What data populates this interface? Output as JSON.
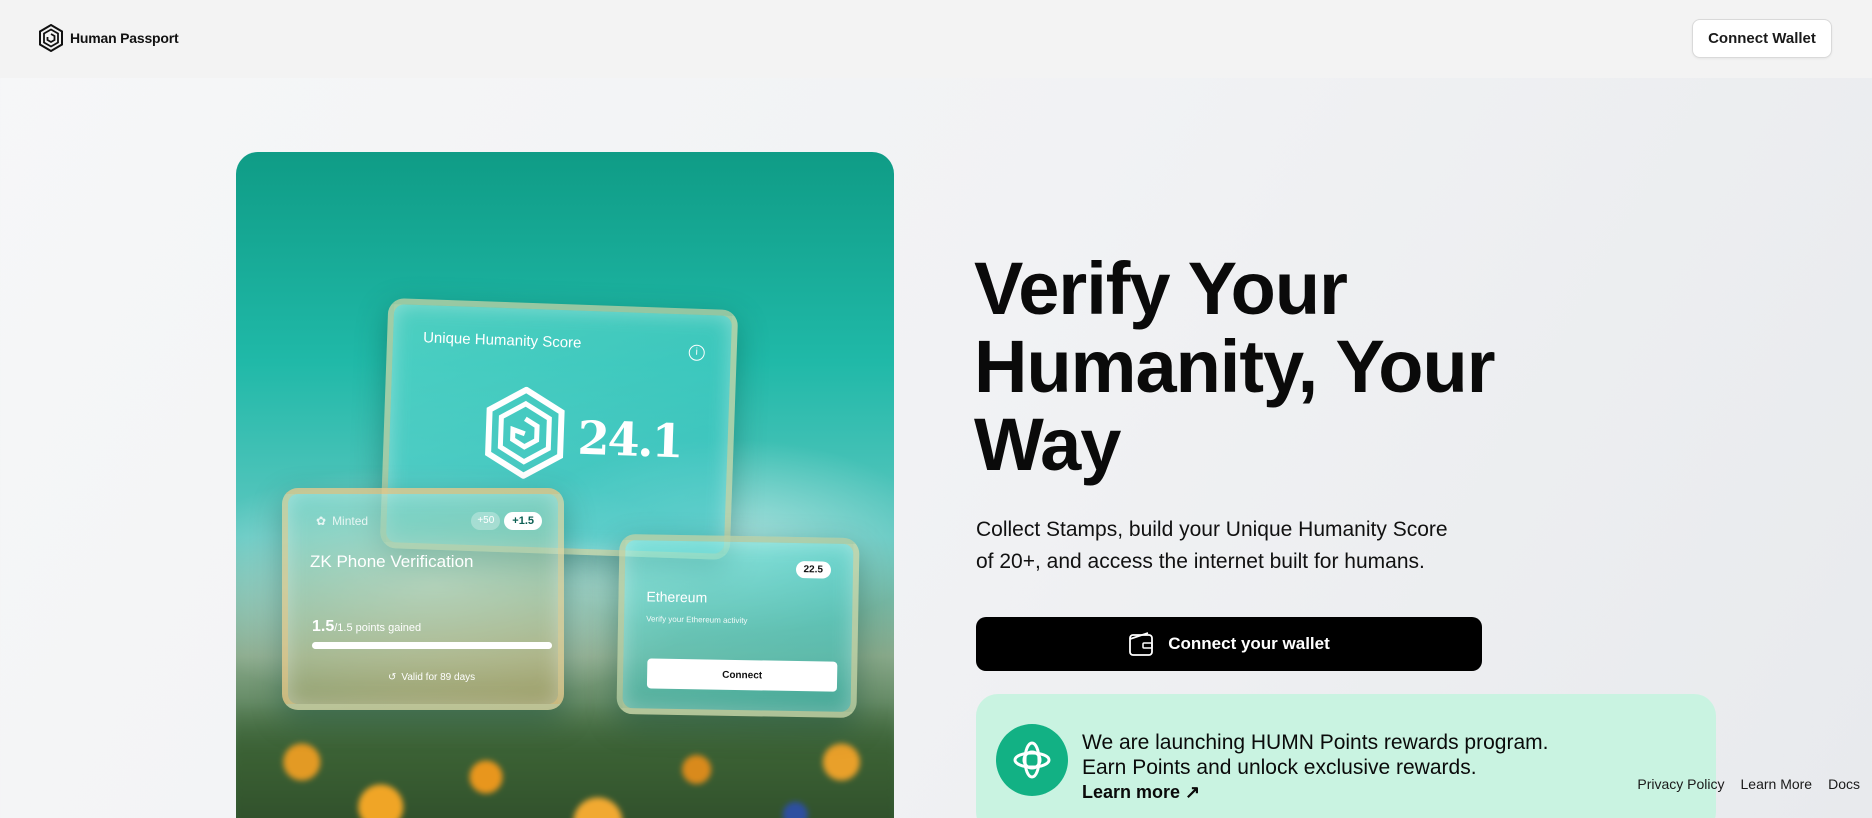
{
  "header": {
    "brand_name": "Human Passport",
    "connect_label": "Connect Wallet"
  },
  "hero_image": {
    "score_card": {
      "title": "Unique Humanity Score",
      "score": "24.1"
    },
    "zk_card": {
      "status": "Minted",
      "badge_small": "+50",
      "badge_main": "+1.5",
      "title": "ZK Phone Verification",
      "points_value": "1.5",
      "points_total": "/1.5",
      "points_label": "points gained",
      "progress_fraction": 1.0,
      "validity": "Valid for 89 days"
    },
    "eth_card": {
      "badge": "22.5",
      "title": "Ethereum",
      "subtitle": "Verify your Ethereum activity",
      "button_label": "Connect"
    },
    "colors": {
      "teal": "#20b9a8",
      "deep_teal": "#0f9c86",
      "flower": "#f0a526"
    }
  },
  "main": {
    "headline_line1": "Verify Your",
    "headline_line2": "Humanity, Your",
    "headline_line3": "Way",
    "subtext_line1": "Collect Stamps, build your Unique Humanity Score",
    "subtext_line2": "of 20+, and access the internet built for humans.",
    "connect_label": "Connect your wallet",
    "connect_icon": "wallet-icon"
  },
  "promo": {
    "line1": "We are launching HUMN Points rewards program.",
    "line2": "Earn Points and unlock exclusive rewards.",
    "link_label": "Learn more ↗",
    "icon": "humn-points-icon",
    "bg_color": "#c9f3e1",
    "icon_color": "#12b184"
  },
  "footer": {
    "links": [
      "Privacy Policy",
      "Learn More",
      "Docs"
    ]
  }
}
